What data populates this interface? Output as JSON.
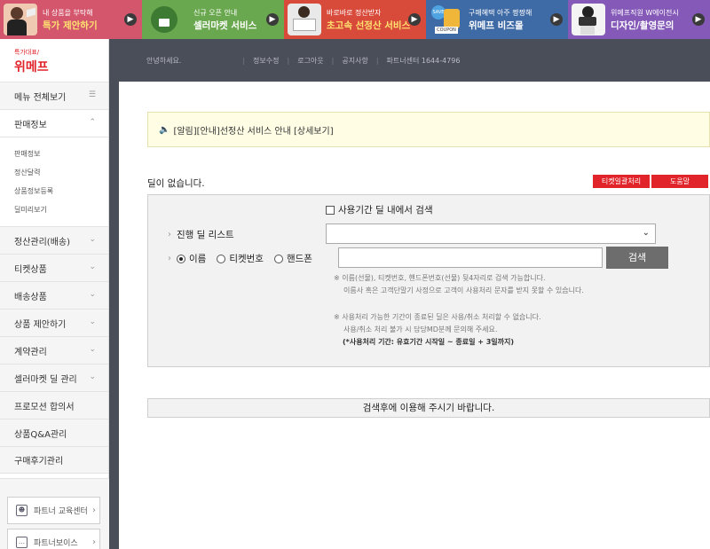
{
  "banners": [
    {
      "small": "내 상품을 부탁해",
      "big": "특가 제안하기",
      "bg": "#d3566c",
      "big_color": "#ffe270"
    },
    {
      "small": "신규 오픈 안내",
      "big": "셀러마켓 서비스",
      "bg": "#6aa84f",
      "big_color": "#ffffff",
      "badge": "위메프 셀러마켓"
    },
    {
      "small": "바로바로 정산받자",
      "big": "초고속 선정산 서비스",
      "bg": "#d84a3a",
      "big_color": "#ffe270"
    },
    {
      "small": "구매혜택 아주 짱짱해",
      "big": "위메프 비즈몰",
      "bg": "#3e6aa6",
      "big_color": "#ffffff",
      "badge": "SAVE"
    },
    {
      "small": "위메프직원 W에이전시",
      "big": "디자인/촬영문의",
      "bg": "#8459b8",
      "big_color": "#ffffff"
    }
  ],
  "logo": {
    "sub": "특가대표/",
    "main": "위메프"
  },
  "sidebar": {
    "all_menu": "메뉴 전체보기",
    "sales_info": "판매정보",
    "sub_items": [
      "판매정보",
      "정산달력",
      "상품정보등록",
      "딜미리보기"
    ],
    "items": [
      "정산관리(배송)",
      "티켓상품",
      "배송상품",
      "상품 제안하기",
      "계약관리",
      "셀러마켓 딜 관리",
      "프로모션 합의서",
      "상품Q&A관리",
      "구매후기관리"
    ],
    "edu_center": "파트너 교육센터",
    "voice": "파트너보이스"
  },
  "topbar": {
    "greeting": "안녕하세요.",
    "links": [
      "정보수정",
      "로그아웃",
      "공지사항",
      "파트너센터 1644-4796"
    ]
  },
  "notice": {
    "text": "[알림][안내]선정산 서비스 안내 [상세보기]"
  },
  "deal_status": "딜이 없습니다.",
  "buttons": {
    "ticket_batch": "티켓일괄처리",
    "help": "도움말",
    "search": "검색"
  },
  "search": {
    "in_period_label": "사용기간 딜 내에서 검색",
    "deal_list_label": "진행 딜 리스트",
    "radio_name": "이름",
    "radio_ticket": "티켓번호",
    "radio_phone": "핸드폰",
    "help1": "※ 이름(선물), 티켓번호, 핸드폰번호(선물) 뒷4자리로 검색 가능합니다.",
    "help2": "이름사 혹은 고객단말기 사정으로 고객이 사용처리 문자를 받지 못할 수 있습니다.",
    "help3": "※ 사용처리 가능한 기간이 종료된 딜은 사용/취소 처리할 수 없습니다.",
    "help4": "사용/취소 처리 불가 시 담당MD분께 문의해 주세요.",
    "help5": "(*사용처리 기간: 유효기간 시작일 ~ 종료일 + 3일까지)"
  },
  "after_search_msg": "검색후에 이용해 주시기 바랍니다.",
  "colors": {
    "brand_red": "#e0242a",
    "topbar": "#4a4e58",
    "notice_bg": "#fffee5",
    "search_btn": "#6d6d6d"
  }
}
